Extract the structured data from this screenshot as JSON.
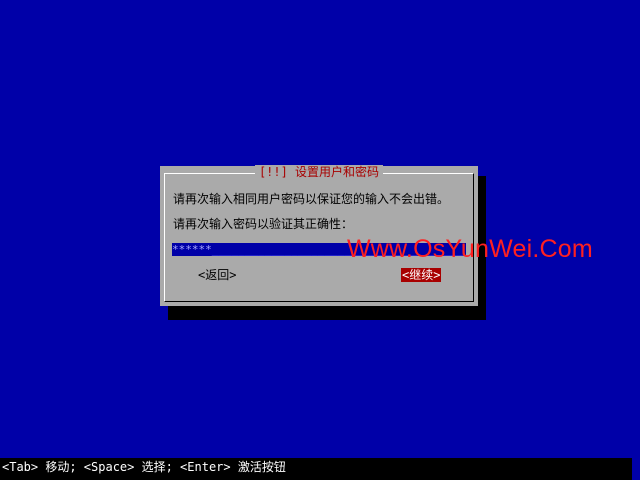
{
  "dialog": {
    "title": "[!!] 设置用户和密码",
    "message": "请再次输入相同用户密码以保证您的输入不会出错。",
    "prompt": "请再次输入密码以验证其正确性：",
    "password_value": "******",
    "password_fill": "________________________________________",
    "back_label": "<返回>",
    "continue_label": "<继续>"
  },
  "watermark": "Www.OsYunWei.Com",
  "help_bar": {
    "text": "<Tab> 移动; <Space> 选择; <Enter> 激活按钮"
  },
  "colors": {
    "background": "#0000a8",
    "dialog": "#aaaaaa",
    "title": "#a80000",
    "focused_button": "#a80000",
    "watermark": "#ff2020"
  }
}
